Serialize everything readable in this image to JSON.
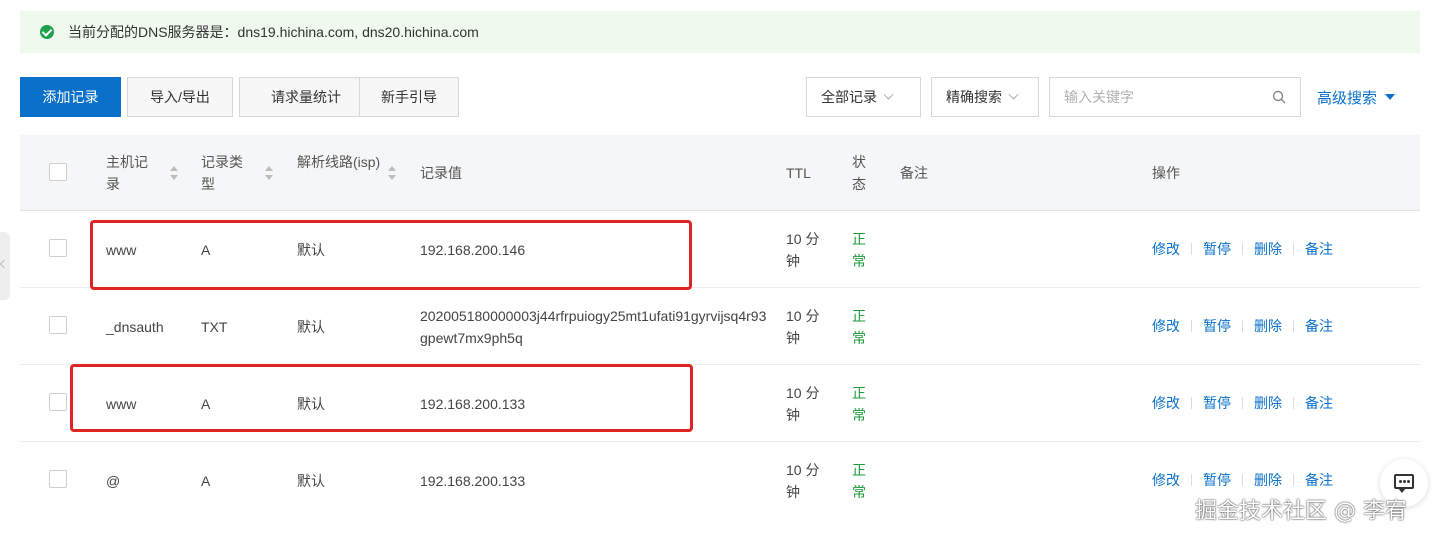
{
  "notice": {
    "text": "当前分配的DNS服务器是：dns19.hichina.com, dns20.hichina.com"
  },
  "toolbar": {
    "add": "添加记录",
    "import_export": "导入/导出",
    "request_stats": "请求量统计",
    "guide": "新手引导",
    "filter_all": "全部记录",
    "search_mode": "精确搜索",
    "search_placeholder": "输入关键字",
    "advanced": "高级搜索"
  },
  "table": {
    "headers": {
      "host": "主机记录",
      "type": "记录类型",
      "line": "解析线路(isp)",
      "value": "记录值",
      "ttl": "TTL",
      "status": "状态",
      "remark": "备注",
      "actions": "操作"
    },
    "rows": [
      {
        "host": "www",
        "type": "A",
        "line": "默认",
        "value": "192.168.200.146",
        "ttl": "10 分钟",
        "status": "正常"
      },
      {
        "host": "_dnsauth",
        "type": "TXT",
        "line": "默认",
        "value": "202005180000003j44rfrpuiogy25mt1ufati91gyrvijsq4r93gpewt7mx9ph5q",
        "ttl": "10 分钟",
        "status": "正常"
      },
      {
        "host": "www",
        "type": "A",
        "line": "默认",
        "value": "192.168.200.133",
        "ttl": "10 分钟",
        "status": "正常"
      },
      {
        "host": "@",
        "type": "A",
        "line": "默认",
        "value": "192.168.200.133",
        "ttl": "10 分钟",
        "status": "正常"
      }
    ],
    "actions": {
      "edit": "修改",
      "pause": "暂停",
      "delete": "删除",
      "remark": "备注"
    }
  },
  "watermark": "掘金技术社区 @ 李宥",
  "colors": {
    "primary": "#0a70c9",
    "status_ok": "#1b9b3a",
    "highlight": "#e02424",
    "notice_bg": "#f0f9ee"
  }
}
